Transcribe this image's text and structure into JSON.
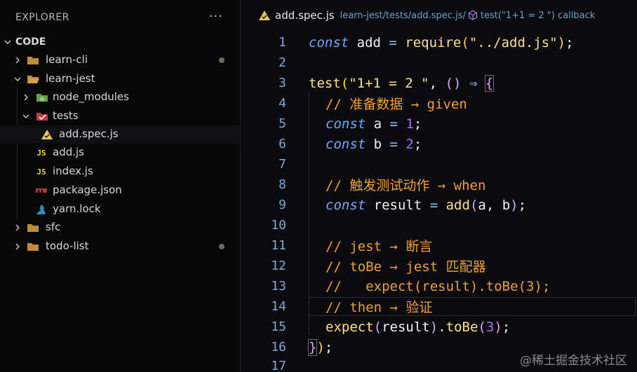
{
  "sidebar": {
    "title": "EXPLORER",
    "more": "···",
    "root": "CODE",
    "items": [
      {
        "label": "learn-cli",
        "type": "folder",
        "modified": true
      },
      {
        "label": "learn-jest",
        "type": "folder-open"
      },
      {
        "label": "node_modules",
        "type": "node-folder"
      },
      {
        "label": "tests",
        "type": "test-folder"
      },
      {
        "label": "add.spec.js",
        "type": "spec-file"
      },
      {
        "label": "add.js",
        "type": "js-file"
      },
      {
        "label": "index.js",
        "type": "js-file"
      },
      {
        "label": "package.json",
        "type": "json-file"
      },
      {
        "label": "yarn.lock",
        "type": "yarn-file"
      },
      {
        "label": "sfc",
        "type": "folder"
      },
      {
        "label": "todo-list",
        "type": "folder",
        "modified": true
      }
    ]
  },
  "breadcrumb": {
    "file": "add.spec.js",
    "path": "learn-jest/tests/add.spec.js/",
    "symbol": "test(\"1+1 = 2 \") callback"
  },
  "code": {
    "line_numbers": [
      "1",
      "2",
      "3",
      "4",
      "5",
      "6",
      "7",
      "8",
      "9",
      "10",
      "11",
      "12",
      "13",
      "14",
      "15",
      "16",
      "17"
    ],
    "l1": {
      "kw": "const",
      "id": " add ",
      "eq": "=",
      "fn": " require",
      "lp": "(",
      "str": "\"../add.js\"",
      "rp": ")",
      "semi": ";"
    },
    "l3": {
      "fn": "test",
      "lp": "(",
      "str": "\"1+1 = 2 \"",
      "comma": ", ",
      "args": "()",
      "arrow": " ⇒ ",
      "brace": "{"
    },
    "l4": "// 准备数据 → given",
    "l5": {
      "kw": "const",
      "id": " a ",
      "eq": "=",
      "num": " 1",
      "semi": ";"
    },
    "l6": {
      "kw": "const",
      "id": " b ",
      "eq": "=",
      "num": " 2",
      "semi": ";"
    },
    "l8": "// 触发测试动作 → when",
    "l9": {
      "kw": "const",
      "id": " result ",
      "eq": "=",
      "fn": " add",
      "lp": "(",
      "args": "a, b",
      "rp": ")",
      "semi": ";"
    },
    "l11": "// jest → 断言",
    "l12": "// toBe → jest 匹配器",
    "l13": "//   expect(result).toBe(3);",
    "l14": "// then → 验证",
    "l15": {
      "fn": "expect",
      "lp": "(",
      "id": "result",
      "rp": ")",
      "dot": ".",
      "fn2": "toBe",
      "lp2": "(",
      "num": "3",
      "rp2": ")",
      "semi": ";"
    },
    "l16": {
      "brace": "}",
      "rp": ")",
      "semi": ";"
    }
  },
  "watermark": "@稀土掘金技术社区",
  "colors": {
    "keyword": "#6ea8ff",
    "string": "#ffe08a",
    "number": "#b06cff",
    "comment": "#f0a030",
    "line_number": "#7ea6d8",
    "path": "#5fa4d8"
  }
}
